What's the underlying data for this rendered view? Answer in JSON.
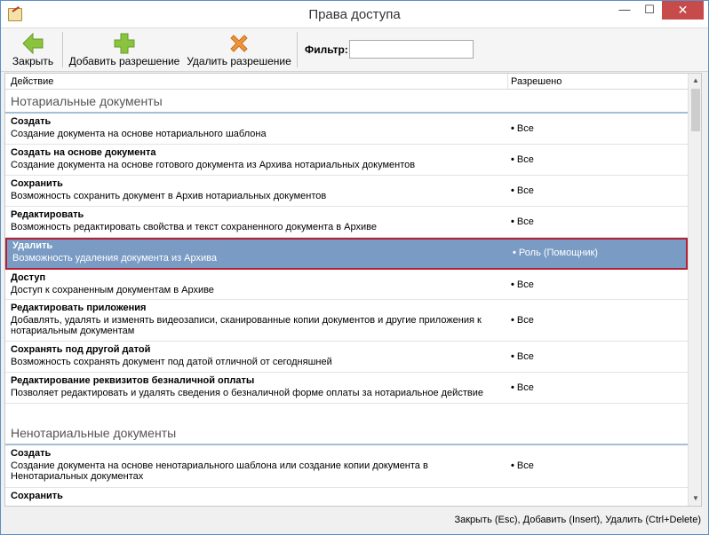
{
  "window": {
    "title": "Права доступа"
  },
  "window_buttons": {
    "minimize": "—",
    "maximize": "☐",
    "close": "✕"
  },
  "toolbar": {
    "close_label": "Закрыть",
    "add_label": "Добавить разрешение",
    "delete_label": "Удалить разрешение",
    "filter_label": "Фильтр:",
    "filter_value": ""
  },
  "grid": {
    "columns": [
      "Действие",
      "Разрешено"
    ],
    "groups": [
      {
        "title": "Нотариальные документы",
        "rows": [
          {
            "name": "Создать",
            "desc": "Создание документа на основе нотариального шаблона",
            "perm": "Все"
          },
          {
            "name": "Создать на основе документа",
            "desc": "Создание документа на основе готового документа из Архива нотариальных документов",
            "perm": "Все"
          },
          {
            "name": "Сохранить",
            "desc": "Возможность сохранить документ в Архив нотариальных документов",
            "perm": "Все"
          },
          {
            "name": "Редактировать",
            "desc": "Возможность редактировать свойства и текст сохраненного документа в Архиве",
            "perm": "Все"
          },
          {
            "name": "Удалить",
            "desc": "Возможность удаления документа из Архива",
            "perm": "Роль (Помощник)"
          },
          {
            "name": "Доступ",
            "desc": "Доступ к сохраненным документам в Архиве",
            "perm": "Все"
          },
          {
            "name": "Редактировать приложения",
            "desc": "Добавлять, удалять и изменять видеозаписи, сканированные копии документов и другие приложения к нотариальным документам",
            "perm": "Все"
          },
          {
            "name": "Сохранять под другой датой",
            "desc": "Возможность сохранять документ под датой отличной от сегодняшней",
            "perm": "Все"
          },
          {
            "name": "Редактирование реквизитов безналичной оплаты",
            "desc": "Позволяет редактировать и удалять сведения о безналичной форме оплаты за нотариальное действие",
            "perm": "Все"
          }
        ]
      },
      {
        "title": "Ненотариальные документы",
        "rows": [
          {
            "name": "Создать",
            "desc": "Создание документа на основе ненотариального шаблона или создание копии документа в Ненотариальных документах",
            "perm": "Все"
          },
          {
            "name": "Сохранить",
            "desc": "",
            "perm": ""
          }
        ]
      }
    ]
  },
  "status": {
    "hint": "Закрыть (Esc), Добавить (Insert), Удалить (Ctrl+Delete)"
  }
}
